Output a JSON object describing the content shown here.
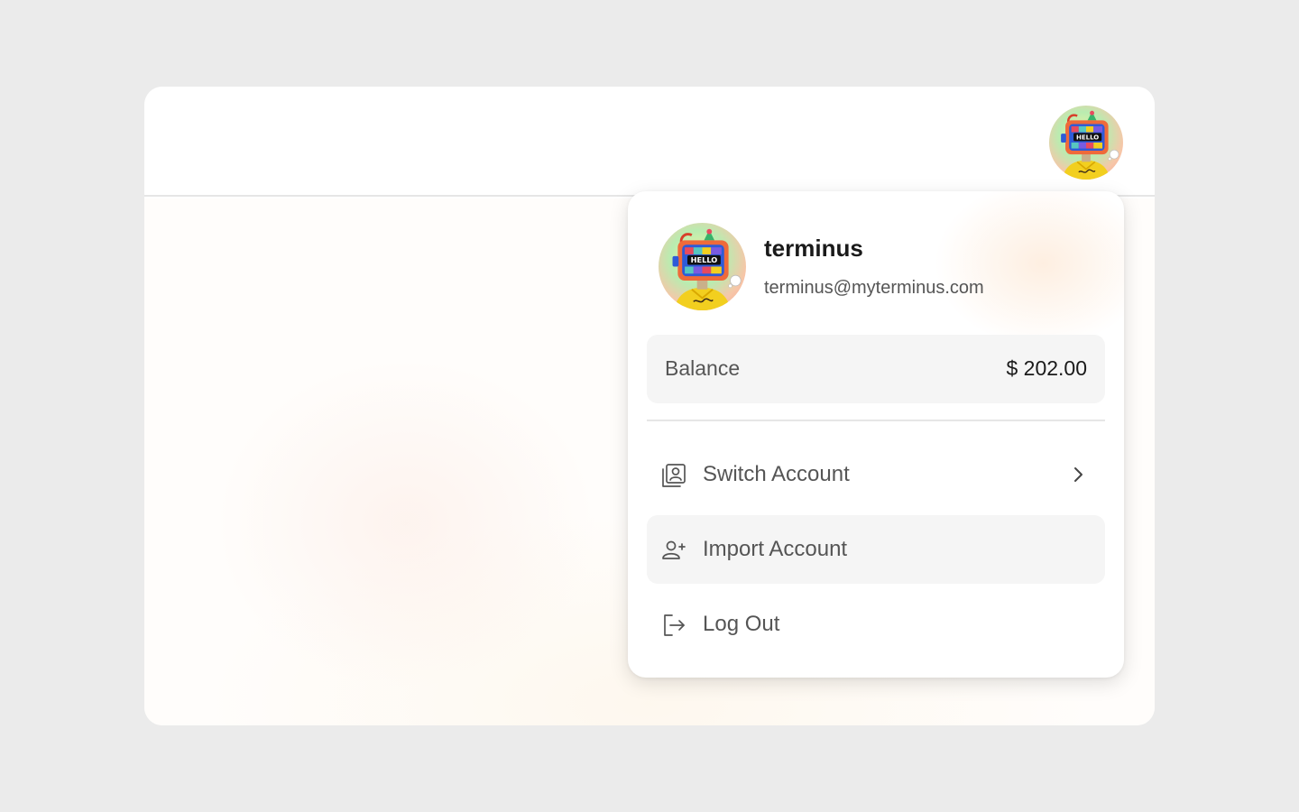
{
  "header": {
    "avatar_icon": "robot-hello-avatar-icon"
  },
  "profile": {
    "name": "terminus",
    "email": "terminus@myterminus.com",
    "avatar_icon": "robot-hello-avatar-icon",
    "avatar_text": "HELLO"
  },
  "balance": {
    "label": "Balance",
    "value": "$ 202.00"
  },
  "menu": {
    "items": [
      {
        "label": "Switch Account",
        "icon": "switch-account-icon",
        "has_chevron": true,
        "hovered": false
      },
      {
        "label": "Import Account",
        "icon": "add-user-icon",
        "has_chevron": false,
        "hovered": true
      },
      {
        "label": "Log Out",
        "icon": "logout-icon",
        "has_chevron": false,
        "hovered": false
      }
    ]
  },
  "colors": {
    "page_bg": "#ebebeb",
    "card_bg": "#ffffff",
    "balance_bg": "#f5f5f5",
    "hover_bg": "#f5f5f5",
    "text_primary": "#1a1a1a",
    "text_secondary": "#555555"
  }
}
